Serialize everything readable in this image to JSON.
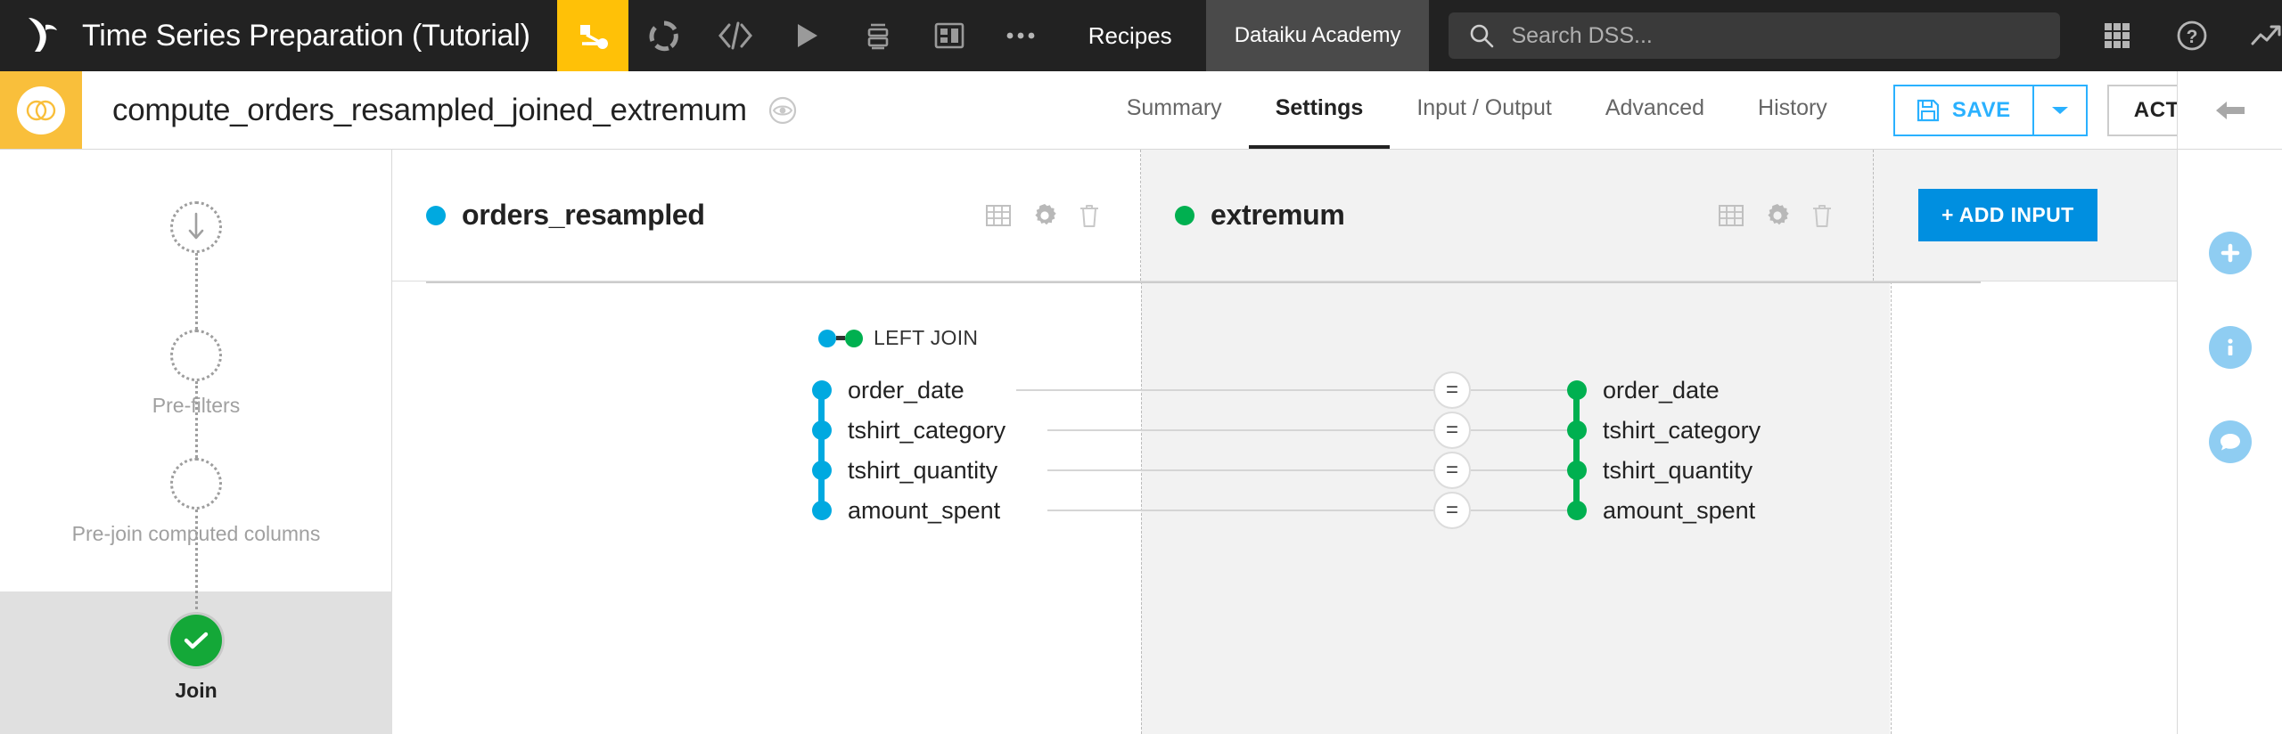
{
  "topbar": {
    "logo_icon": "dataiku-bird-logo",
    "project_title": "Time Series Preparation (Tutorial)",
    "nav_icons": [
      {
        "name": "flow-icon",
        "label": "Flow",
        "active": true
      },
      {
        "name": "lab-icon",
        "label": "Lab",
        "active": false
      },
      {
        "name": "code-icon",
        "label": "Code",
        "active": false
      },
      {
        "name": "jobs-icon",
        "label": "Jobs",
        "active": false
      },
      {
        "name": "automation-icon",
        "label": "Automation",
        "active": false
      },
      {
        "name": "dashboards-icon",
        "label": "Dashboards",
        "active": false
      },
      {
        "name": "more-icon",
        "label": "More",
        "active": false
      }
    ],
    "recipes_label": "Recipes",
    "academy_label": "Dataiku Academy",
    "search": {
      "icon": "search-icon",
      "placeholder": "Search DSS...",
      "value": ""
    },
    "right_icons": [
      {
        "name": "apps-grid-icon"
      },
      {
        "name": "help-question-icon"
      },
      {
        "name": "activity-trend-icon"
      }
    ],
    "avatar": {
      "name": "user-avatar",
      "has_notification": true
    },
    "colors": {
      "bar_bg": "#222222",
      "accent_yellow": "#ffc107",
      "academy_bg": "#4a4a4a",
      "notification_red": "#e51b00"
    }
  },
  "subbar": {
    "recipe_icon": "join-recipe-icon",
    "recipe_name": "compute_orders_resampled_joined_extremum",
    "view_icon": "eye-preview-icon",
    "tabs": [
      {
        "label": "Summary",
        "active": false
      },
      {
        "label": "Settings",
        "active": true
      },
      {
        "label": "Input / Output",
        "active": false
      },
      {
        "label": "Advanced",
        "active": false
      },
      {
        "label": "History",
        "active": false
      }
    ],
    "save_label": "SAVE",
    "save_icon": "floppy-disk-icon",
    "save_caret_icon": "chevron-down-icon",
    "actions_label": "ACTIONS",
    "colors": {
      "badge_bg": "#f9bf3b",
      "save_blue": "#2ab1ff",
      "actions_border": "#cccccc"
    }
  },
  "steps_rail": {
    "steps": [
      {
        "label": "",
        "state": "arrow",
        "icon": "download-arrow-icon"
      },
      {
        "label": "Pre-filters",
        "state": "empty"
      },
      {
        "label": "Pre-join computed columns",
        "state": "empty"
      },
      {
        "label": "Join",
        "state": "done",
        "icon": "check-icon",
        "selected": true
      }
    ]
  },
  "join_editor": {
    "left_dataset": {
      "name": "orders_resampled",
      "dot_color": "#00a9e0",
      "tools": [
        {
          "name": "table-view-icon"
        },
        {
          "name": "gear-settings-icon"
        },
        {
          "name": "trash-delete-icon"
        }
      ]
    },
    "right_dataset": {
      "name": "extremum",
      "dot_color": "#00b050",
      "tools": [
        {
          "name": "table-view-icon"
        },
        {
          "name": "gear-settings-icon"
        },
        {
          "name": "trash-delete-icon"
        }
      ]
    },
    "add_input_label": "+ ADD INPUT",
    "join_type": {
      "label": "LEFT JOIN",
      "left_dot": "#00a9e0",
      "right_dot": "#00b050"
    },
    "conditions": [
      {
        "left": "order_date",
        "operator": "=",
        "right": "order_date"
      },
      {
        "left": "tshirt_category",
        "operator": "=",
        "right": "tshirt_category"
      },
      {
        "left": "tshirt_quantity",
        "operator": "=",
        "right": "tshirt_quantity"
      },
      {
        "left": "amount_spent",
        "operator": "=",
        "right": "amount_spent"
      }
    ]
  },
  "right_rail": {
    "collapse_icon": "arrow-left-collapse-icon",
    "buttons": [
      {
        "name": "add-plus-icon",
        "glyph": "+"
      },
      {
        "name": "info-icon",
        "glyph": "i"
      },
      {
        "name": "discussions-chat-icon",
        "glyph": "●"
      }
    ],
    "accent_color": "#8fcdf2"
  }
}
